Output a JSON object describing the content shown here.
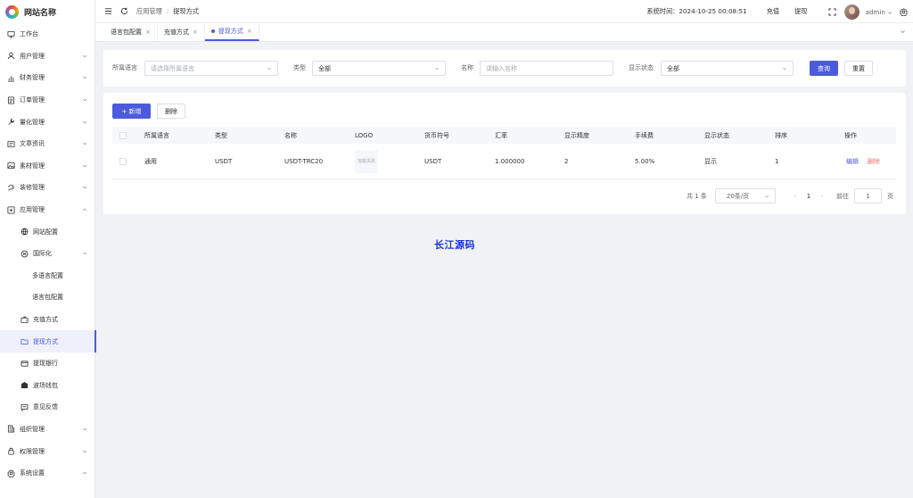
{
  "site": {
    "name": "网站名称"
  },
  "sidebar": {
    "items": [
      {
        "label": "工作台",
        "icon": "monitor-icon",
        "level": 0,
        "chevron": false
      },
      {
        "label": "用户管理",
        "icon": "user-icon",
        "level": 0,
        "chevron": true
      },
      {
        "label": "财务管理",
        "icon": "chart-icon",
        "level": 0,
        "chevron": true
      },
      {
        "label": "订单管理",
        "icon": "list-icon",
        "level": 0,
        "chevron": true
      },
      {
        "label": "量化管理",
        "icon": "tool-icon",
        "level": 0,
        "chevron": true
      },
      {
        "label": "文章资讯",
        "icon": "article-icon",
        "level": 0,
        "chevron": true
      },
      {
        "label": "素材管理",
        "icon": "image-icon",
        "level": 0,
        "chevron": true
      },
      {
        "label": "装修管理",
        "icon": "decor-icon",
        "level": 0,
        "chevron": true
      },
      {
        "label": "应用管理",
        "icon": "app-icon",
        "level": 0,
        "chevron": true,
        "expanded": true
      },
      {
        "label": "网站配置",
        "icon": "globe-icon",
        "level": 1,
        "chevron": false
      },
      {
        "label": "国际化",
        "icon": "i18n-icon",
        "level": 1,
        "chevron": true,
        "expanded": true
      },
      {
        "label": "多语言配置",
        "icon": "",
        "level": 2,
        "chevron": false
      },
      {
        "label": "语言包配置",
        "icon": "",
        "level": 2,
        "chevron": false
      },
      {
        "label": "充值方式",
        "icon": "wallet-icon",
        "level": 1,
        "chevron": false
      },
      {
        "label": "提现方式",
        "icon": "folder-icon",
        "level": 1,
        "chevron": false,
        "active": true
      },
      {
        "label": "提现银行",
        "icon": "card-icon",
        "level": 1,
        "chevron": false
      },
      {
        "label": "波场钱包",
        "icon": "purse-icon",
        "level": 1,
        "chevron": false
      },
      {
        "label": "意见反馈",
        "icon": "message-icon",
        "level": 1,
        "chevron": false
      },
      {
        "label": "组织管理",
        "icon": "org-icon",
        "level": 0,
        "chevron": true
      },
      {
        "label": "权限管理",
        "icon": "lock-icon",
        "level": 0,
        "chevron": true
      },
      {
        "label": "系统设置",
        "icon": "gear-icon",
        "level": 0,
        "chevron": true
      }
    ]
  },
  "header": {
    "breadcrumb": [
      "应用管理",
      "提现方式"
    ],
    "breadcrumb_sep": "/",
    "system_time": "系统时间：2024-10-25 00:08:51",
    "recharge": "充值",
    "withdraw": "提现",
    "username": "admin"
  },
  "tabs": [
    {
      "label": "语言包配置",
      "active": false
    },
    {
      "label": "充值方式",
      "active": false
    },
    {
      "label": "提现方式",
      "active": true
    }
  ],
  "filter": {
    "lang_label": "所属语言",
    "lang_placeholder": "请选择所属语言",
    "type_label": "类型",
    "type_value": "全部",
    "name_label": "名称",
    "name_placeholder": "请输入名称",
    "status_label": "显示状态",
    "status_value": "全部",
    "query": "查询",
    "reset": "重置"
  },
  "toolbar": {
    "add": "+ 新增",
    "delete": "删除"
  },
  "table": {
    "columns": [
      "所属语言",
      "类型",
      "名称",
      "LOGO",
      "货币符号",
      "汇率",
      "显示精度",
      "手续费",
      "显示状态",
      "排序",
      "操作"
    ],
    "rows": [
      {
        "lang": "通用",
        "type": "USDT",
        "name": "USDT-TRC20",
        "logo": "加载失败",
        "symbol": "USDT",
        "rate": "1.000000",
        "precision": "2",
        "fee": "5.00%",
        "status": "显示",
        "sort": "1",
        "edit": "编辑",
        "delete": "删除"
      }
    ]
  },
  "pagination": {
    "total": "共 1 条",
    "size": "20条/页",
    "prev": "‹",
    "page": "1",
    "next": "›",
    "goto": "前往",
    "goto_value": "1",
    "page_suffix": "页"
  },
  "watermark": "长江源码",
  "colors": {
    "primary": "#4c5bdb",
    "danger": "#f56c6c",
    "bg": "#f0f2f5"
  }
}
